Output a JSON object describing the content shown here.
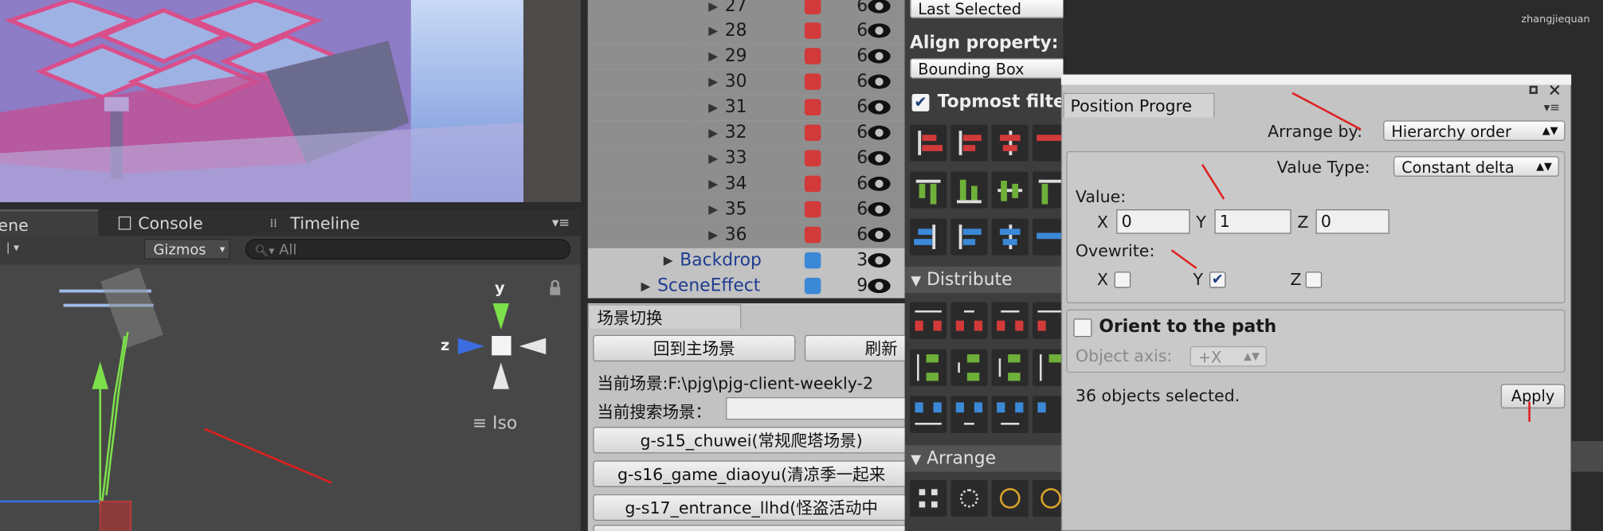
{
  "colors": {
    "accent_arrow": "#e02020",
    "cube_red": "#d23a3a",
    "cube_blue": "#3b88d6",
    "axis_y": "#7de04a",
    "axis_z": "#3b6de0"
  },
  "scene_tabs": [
    {
      "label": "ene",
      "icon": "scene-icon"
    },
    {
      "label": "Console",
      "icon": "console-icon"
    },
    {
      "label": "Timeline",
      "icon": "timeline-icon"
    }
  ],
  "scene_toolbar": {
    "gizmos": "Gizmos",
    "search_placeholder": "All"
  },
  "scene_gizmo": {
    "y": "y",
    "z": "z",
    "projection": "Iso"
  },
  "hierarchy": {
    "rows": [
      {
        "name": "27",
        "count": "6"
      },
      {
        "name": "28",
        "count": "6"
      },
      {
        "name": "29",
        "count": "6"
      },
      {
        "name": "30",
        "count": "6"
      },
      {
        "name": "31",
        "count": "6"
      },
      {
        "name": "32",
        "count": "6"
      },
      {
        "name": "33",
        "count": "6"
      },
      {
        "name": "34",
        "count": "6"
      },
      {
        "name": "35",
        "count": "6"
      },
      {
        "name": "36",
        "count": "6"
      }
    ],
    "backdrop": {
      "name": "Backdrop",
      "count": "3"
    },
    "scene_effect": {
      "name": "SceneEffect",
      "count": "9"
    }
  },
  "switch_panel": {
    "tab": "场景切换",
    "home_button": "回到主场景",
    "refresh_button": "刷新",
    "current_scene_label": "当前场景:F:\\pjg\\pjg-client-weekly-2",
    "search_scene_label": "当前搜索场景：",
    "scenes": [
      "g-s15_chuwei(常规爬塔场景)",
      "g-s16_game_diaoyu(清凉季一起来",
      "g-s17_entrance_llhd(怪盗活动中"
    ]
  },
  "align_panel": {
    "reference_dropdown": "Last Selected",
    "align_property_label": "Align property:",
    "align_property_value": "Bounding Box",
    "topmost_filter": "Topmost filter",
    "distribute": "Distribute",
    "arrange": "Arrange"
  },
  "position_progression": {
    "tab": "Position Progre",
    "arrange_by_label": "Arrange by:",
    "arrange_by_value": "Hierarchy order",
    "value_type_label": "Value Type:",
    "value_type_value": "Constant delta",
    "value_label": "Value:",
    "x_label": "X",
    "x_value": "0",
    "y_label": "Y",
    "y_value": "1",
    "z_label": "Z",
    "z_value": "0",
    "overwrite_label": "Ovewrite:",
    "overwrite": {
      "x": false,
      "y": true,
      "z": false
    },
    "orient_label": "Orient to the path",
    "orient_checked": false,
    "object_axis_label": "Object axis:",
    "object_axis_value": "+X",
    "status": "36 objects selected.",
    "apply": "Apply"
  },
  "watermark": "zhangjiequan"
}
